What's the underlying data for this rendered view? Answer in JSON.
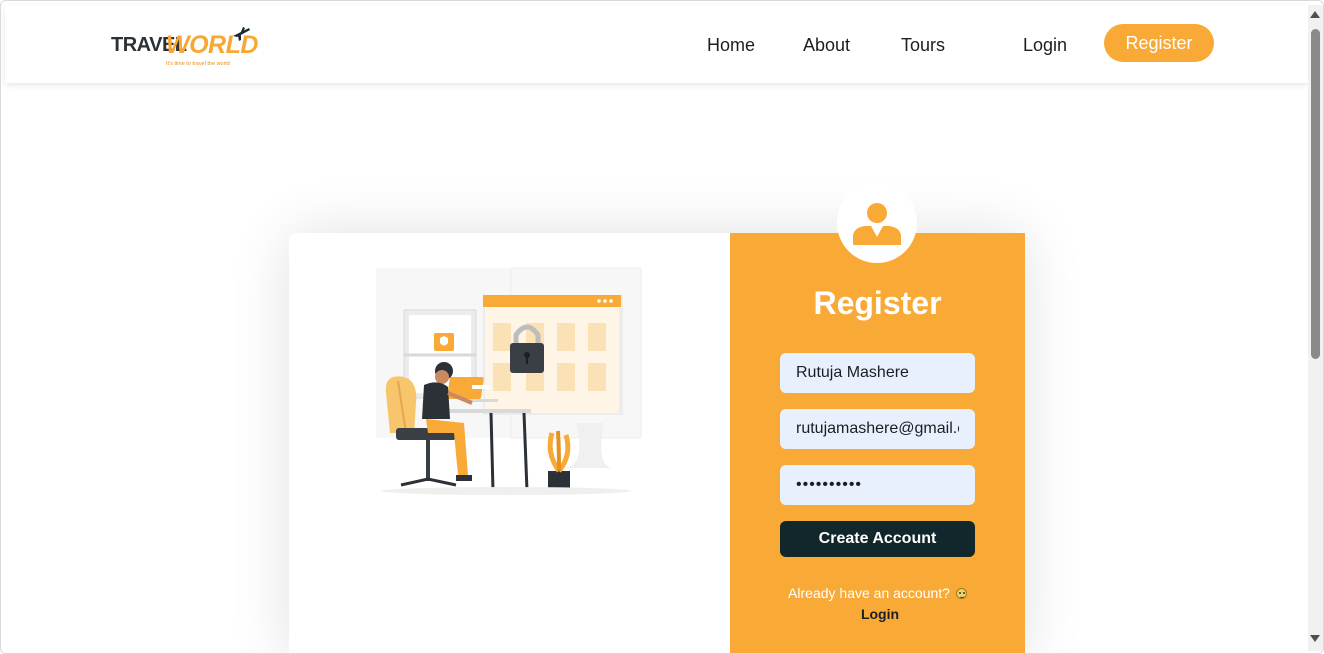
{
  "brand": {
    "part1": "TRAVEL",
    "part2": "WORLD",
    "tagline": "It's time to travel the world"
  },
  "nav": {
    "home": "Home",
    "about": "About",
    "tours": "Tours",
    "login": "Login",
    "register": "Register"
  },
  "form": {
    "title": "Register",
    "username_value": "Rutuja Mashere",
    "email_value": "rutujamashere@gmail.com",
    "password_value": "••••••••••",
    "submit_label": "Create Account",
    "already_text": "Already have an account?",
    "login_label": "Login"
  },
  "colors": {
    "accent": "#f9a935",
    "dark_button": "#11272b",
    "input_bg": "#e8f0fe"
  },
  "icons": [
    "airplane-icon",
    "user-avatar-icon",
    "smile-emoji-icon"
  ]
}
